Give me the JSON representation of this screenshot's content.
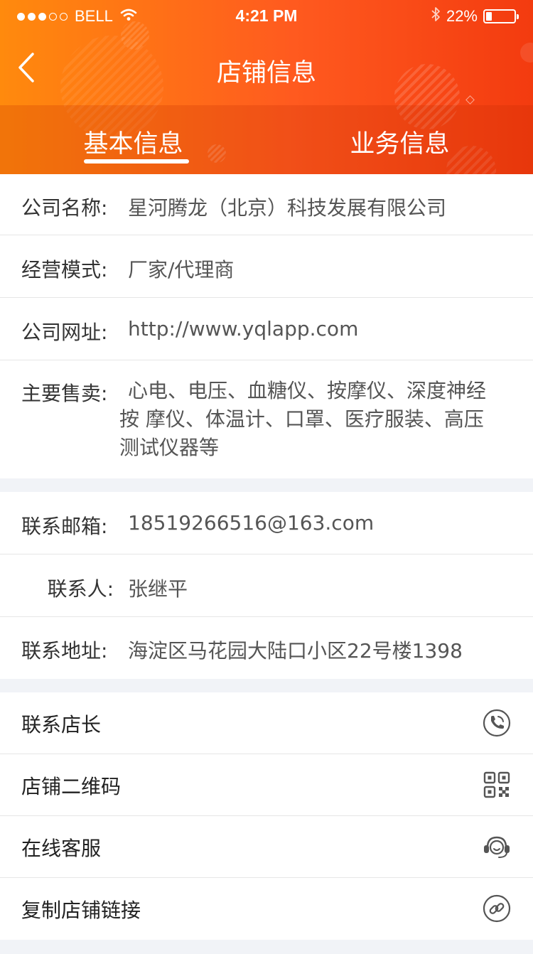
{
  "status_bar": {
    "carrier": "BELL",
    "time": "4:21 PM",
    "battery_text": "22%",
    "battery_level": 0.22,
    "signal_bars_filled": 3,
    "signal_bars_total": 5
  },
  "header": {
    "title": "店铺信息",
    "back_icon": "chevron-left-icon",
    "tabs": [
      {
        "label": "基本信息",
        "active": true
      },
      {
        "label": "业务信息",
        "active": false
      }
    ]
  },
  "company_info": {
    "name_label": "公司名称:",
    "name_value": "星河腾龙（北京）科技发展有限公司",
    "mode_label": "经营模式:",
    "mode_value": "厂家/代理商",
    "website_label": "公司网址:",
    "website_value": "http://www.yqlapp.com",
    "products_label": "主要售卖:",
    "products_value_line1": "心电、电压、血糖仪、按摩仪、深度神经",
    "products_value_line2": "按 摩仪、体温计、口罩、医疗服装、高压",
    "products_value_line3": "测试仪器等"
  },
  "contact_info": {
    "email_label": "联系邮箱:",
    "email_value": "18519266516@163.com",
    "person_label": "联系人:",
    "person_value": "张继平",
    "address_label": "联系地址:",
    "address_value": "海淀区马花园大陆口小区22号楼1398"
  },
  "actions": [
    {
      "label": "联系店长",
      "icon": "phone-icon"
    },
    {
      "label": "店铺二维码",
      "icon": "qr-code-icon"
    },
    {
      "label": "在线客服",
      "icon": "headset-icon"
    },
    {
      "label": "复制店铺链接",
      "icon": "link-icon"
    }
  ],
  "colors": {
    "header_start": "#ff8a0d",
    "header_end": "#f33b0f",
    "background": "#f1f3f7",
    "icon_gray": "#555555"
  }
}
